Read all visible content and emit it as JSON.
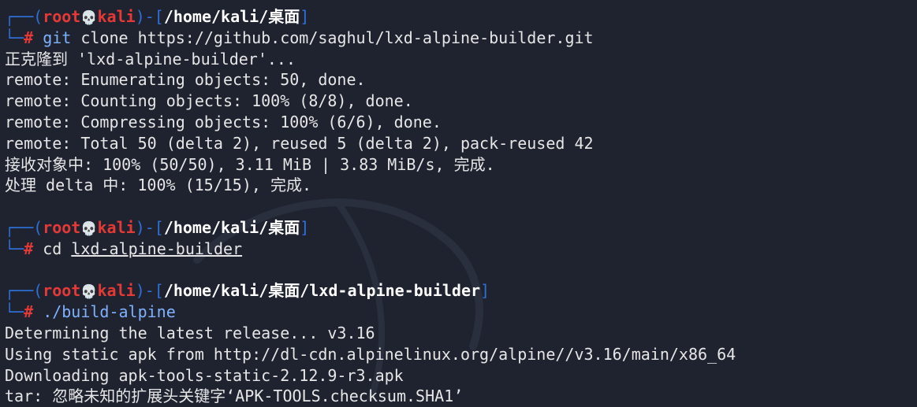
{
  "colors": {
    "background": "#1f2330",
    "prompt_bracket": "#2f6fd6",
    "prompt_user": "#e53935",
    "prompt_path": "#ffffff",
    "command_keyword": "#7fb1ff",
    "output_text": "#e6e6e6"
  },
  "prompts": [
    {
      "user": "root",
      "host": "kali",
      "path": "/home/kali/桌面",
      "symbol": "#",
      "command_keyword": "git",
      "command_rest": " clone https://github.com/saghul/lxd-alpine-builder.git"
    },
    {
      "user": "root",
      "host": "kali",
      "path": "/home/kali/桌面",
      "symbol": "#",
      "command_keyword": "cd",
      "command_rest": "lxd-alpine-builder"
    },
    {
      "user": "root",
      "host": "kali",
      "path": "/home/kali/桌面/lxd-alpine-builder",
      "symbol": "#",
      "command_keyword": "./build-alpine",
      "command_rest": ""
    }
  ],
  "outputs": {
    "block1": [
      "正克隆到 'lxd-alpine-builder'...",
      "remote: Enumerating objects: 50, done.",
      "remote: Counting objects: 100% (8/8), done.",
      "remote: Compressing objects: 100% (6/6), done.",
      "remote: Total 50 (delta 2), reused 5 (delta 2), pack-reused 42",
      "接收对象中: 100% (50/50), 3.11 MiB | 3.83 MiB/s, 完成.",
      "处理 delta 中: 100% (15/15), 完成."
    ],
    "block3": [
      "Determining the latest release... v3.16",
      "Using static apk from http://dl-cdn.alpinelinux.org/alpine//v3.16/main/x86_64",
      "Downloading apk-tools-static-2.12.9-r3.apk",
      "tar: 忽略未知的扩展头关键字‘APK-TOOLS.checksum.SHA1’"
    ]
  },
  "icons": {
    "prompt_separator": "skull-icon",
    "background_watermark": "kali-dragon-icon"
  }
}
